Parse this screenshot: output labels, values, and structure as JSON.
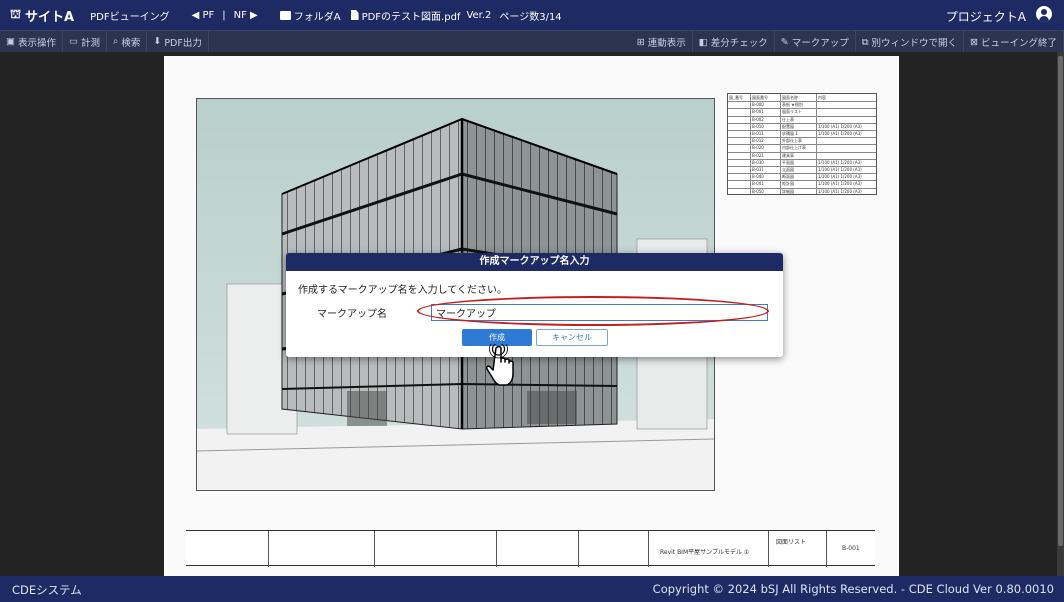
{
  "header": {
    "site_icon": "⛫",
    "site_name": "サイトA",
    "mode": "PDFビューイング",
    "prev_label": "◀ PF",
    "separator": "|",
    "next_label": "NF ▶",
    "folder": "フォルダA",
    "file": "PDFのテスト図面.pdf",
    "version": "Ver.2",
    "page_info": "ページ数3/14",
    "project": "プロジェクトA"
  },
  "toolbar": {
    "display_ops": "表示操作",
    "measure": "計測",
    "search": "検索",
    "pdf_output": "PDF出力",
    "sync_display": "連動表示",
    "diff_check": "差分チェック",
    "markup": "マークアップ",
    "open_window": "別ウィンドウで開く",
    "end_viewing": "ビューイング終了",
    "icons": {
      "display_ops": "▣",
      "measure": "▭",
      "search": "⌕",
      "pdf_output": "⬇",
      "sync_display": "⊞",
      "diff_check": "◧",
      "markup": "✎",
      "open_window": "⧉",
      "end_viewing": "⊠"
    }
  },
  "drawing": {
    "title_block": {
      "project_name": "Revit BIM平屋サンプルモデル ①",
      "drawing_name": "図面リスト",
      "sheet_number": "B-001"
    },
    "schedule": {
      "headers": [
        "図_番号",
        "図面番号",
        "図面名称",
        "内容"
      ],
      "rows": [
        [
          "",
          "B-000",
          "表紙 ★個別",
          ""
        ],
        [
          "",
          "B-001",
          "図面リスト",
          ""
        ],
        [
          "",
          "B-002",
          "仕上表",
          ""
        ],
        [
          "",
          "B-010",
          "配置図",
          "1/100 (A1) 1/200 (A3)"
        ],
        [
          "",
          "B-011",
          "求積図 1",
          "1/100 (A1) 1/200 (A3)"
        ],
        [
          "",
          "B-012",
          "外部仕上表",
          ""
        ],
        [
          "",
          "B-020",
          "内部仕上げ表",
          ""
        ],
        [
          "",
          "B-021",
          "建具表",
          ""
        ],
        [
          "",
          "B-030",
          "平面図",
          "1/100 (A1) 1/200 (A3)"
        ],
        [
          "",
          "B-031",
          "立面図",
          "1/100 (A1) 1/200 (A3)"
        ],
        [
          "",
          "B-040",
          "断面図",
          "1/100 (A1) 1/200 (A3)"
        ],
        [
          "",
          "B-041",
          "矩計図",
          "1/100 (A1) 1/200 (A3)"
        ],
        [
          "",
          "B-050",
          "詳細図",
          "1/100 (A1) 1/200 (A3)"
        ]
      ]
    }
  },
  "modal": {
    "title": "作成マークアップ名入力",
    "message": "作成するマークアップ名を入力してください。",
    "field_label": "マークアップ名",
    "field_value": "マークアップ",
    "create_button": "作成",
    "cancel_button": "キャンセル"
  },
  "footer": {
    "system_name": "CDEシステム",
    "copyright": "Copyright © 2024 bSJ All Rights Reserved. - CDE Cloud Ver 0.80.0010"
  },
  "colors": {
    "header_bg": "#1d2a63",
    "primary_button": "#2e7bd6",
    "highlight": "#c41e1e"
  }
}
